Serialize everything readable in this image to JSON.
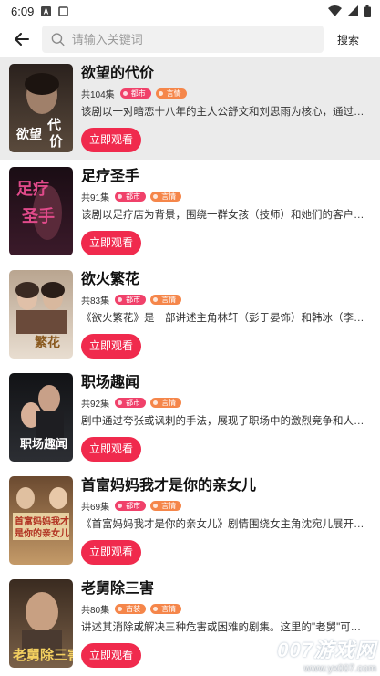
{
  "status_bar": {
    "time": "6:09"
  },
  "search": {
    "placeholder": "请输入关键词",
    "button_label": "搜索"
  },
  "items": [
    {
      "title": "欲望的代价",
      "episodes": "共104集",
      "tags": [
        "都市",
        "言情"
      ],
      "desc": "该剧以一对暗恋十八年的主人公舒文和刘思雨为核心，通过…",
      "button": "立即观看",
      "cover_text": "欲望的代价",
      "cover_colors": [
        "#2a211d",
        "#5a4a3c"
      ]
    },
    {
      "title": "足疗圣手",
      "episodes": "共91集",
      "tags": [
        "都市",
        "言情"
      ],
      "desc": "该剧以足疗店为背景，围绕一群女孩（技师）和她们的客户…",
      "button": "立即观看",
      "cover_text": "足疗圣手",
      "cover_colors": [
        "#1a0d14",
        "#3b1a2a"
      ]
    },
    {
      "title": "欲火繁花",
      "episodes": "共83集",
      "tags": [
        "都市",
        "言情"
      ],
      "desc": "《欲火繁花》是一部讲述主角林轩（彭于晏饰）和韩冰（李…",
      "button": "立即观看",
      "cover_text": "欲火繁花",
      "cover_colors": [
        "#b9a590",
        "#e8ddd0"
      ]
    },
    {
      "title": "职场趣闻",
      "episodes": "共92集",
      "tags": [
        "都市",
        "言情"
      ],
      "desc": "剧中通过夸张或讽刺的手法，展现了职场中的激烈竞争和人…",
      "button": "立即观看",
      "cover_text": "职场趣闻",
      "cover_colors": [
        "#121316",
        "#2c2e33"
      ]
    },
    {
      "title": "首富妈妈我才是你的亲女儿",
      "episodes": "共69集",
      "tags": [
        "都市",
        "言情"
      ],
      "desc": "《首富妈妈我才是你的亲女儿》剧情围绕女主角沈宛儿展开…",
      "button": "立即观看",
      "cover_text": "首富妈妈我才是你的亲女儿",
      "cover_colors": [
        "#6b4a30",
        "#c49a68"
      ]
    },
    {
      "title": "老舅除三害",
      "episodes": "共80集",
      "tags": [
        "古装",
        "言情"
      ],
      "desc": "讲述其消除或解决三种危害或困难的剧集。这里的\"老舅\"可…",
      "button": "立即观看",
      "cover_text": "老舅除三害",
      "cover_colors": [
        "#3a2b20",
        "#7a6048"
      ]
    }
  ],
  "watermark": {
    "logo": "007游戏网",
    "url": "www.yx007.com"
  }
}
